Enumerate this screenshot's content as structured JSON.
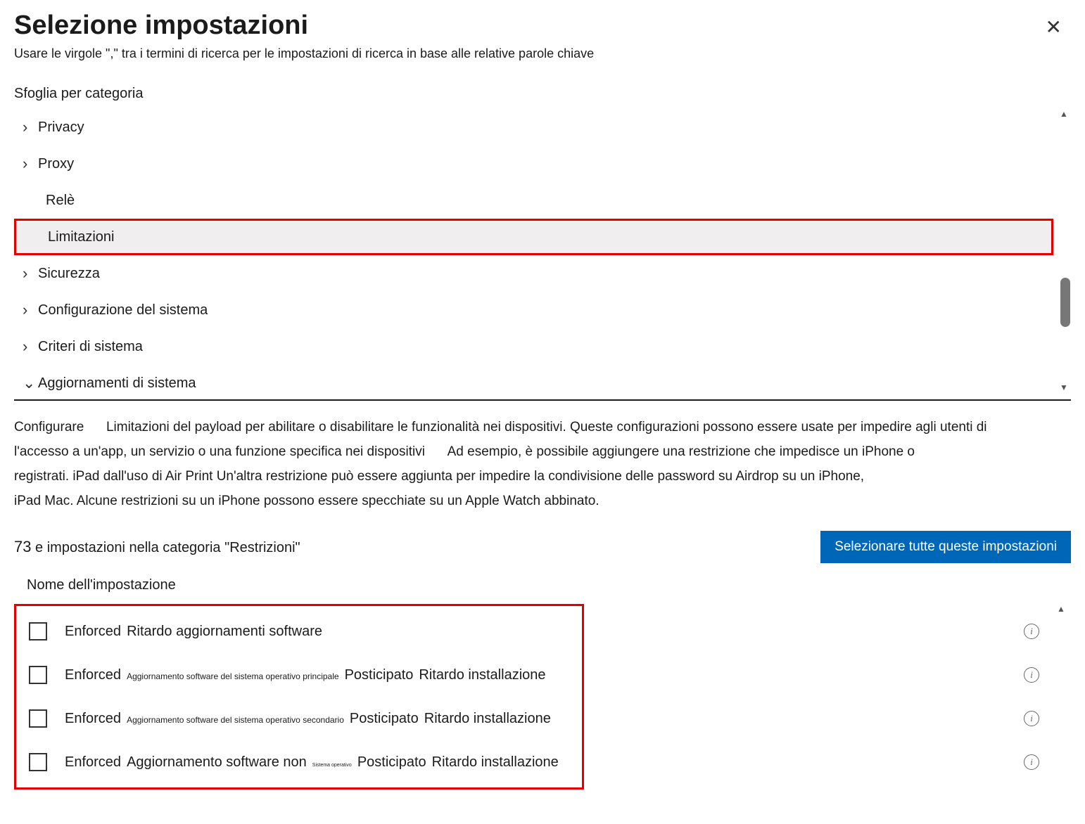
{
  "header": {
    "title": "Selezione impostazioni",
    "subtitle": "Usare le virgole \",\" tra i termini di ricerca per le impostazioni di ricerca in base alle relative parole chiave"
  },
  "browse_label": "Sfoglia per categoria",
  "categories": [
    {
      "label": "Privacy",
      "has_chevron": true
    },
    {
      "label": "Proxy",
      "has_chevron": true
    },
    {
      "label": "Relè",
      "has_chevron": false,
      "indented": true
    },
    {
      "label": "Limitazioni",
      "has_chevron": false,
      "indented": true,
      "selected": true
    },
    {
      "label": "Sicurezza",
      "has_chevron": true
    },
    {
      "label": "Configurazione del sistema",
      "has_chevron": true
    },
    {
      "label": "Criteri di sistema",
      "has_chevron": true
    },
    {
      "label": "Aggiornamenti di sistema",
      "has_chevron": true,
      "expanded": true
    }
  ],
  "description": {
    "line1_a": "Configurare",
    "line1_b": "Limitazioni del payload per abilitare o disabilitare le funzionalità nei dispositivi. Queste configurazioni possono essere usate per impedire agli utenti di",
    "line2_a": "l'accesso a un'app, un servizio o una funzione specifica nei dispositivi",
    "line2_b": "Ad esempio, è possibile aggiungere una restrizione che impedisce un iPhone o",
    "line3": "registrati. iPad dall'uso di Air Print Un'altra restrizione può essere aggiunta per impedire la condivisione delle password su Airdrop su un iPhone,",
    "line4": "iPad  Mac. Alcune restrizioni su un iPhone possono essere specchiate su un Apple Watch abbinato."
  },
  "count": {
    "num": "73",
    "text": "e impostazioni nella categoria \"Restrizioni\""
  },
  "select_all_btn": "Selezionare tutte queste impostazioni",
  "settings_header": "Nome dell'impostazione",
  "settings": [
    {
      "parts": [
        {
          "t": "Enforced",
          "s": "n"
        },
        {
          "t": "Ritardo aggiornamenti software",
          "s": "n"
        }
      ]
    },
    {
      "parts": [
        {
          "t": "Enforced",
          "s": "n"
        },
        {
          "t": "Aggiornamento software del sistema operativo principale",
          "s": "sm"
        },
        {
          "t": "Posticipato",
          "s": "n"
        },
        {
          "t": "Ritardo installazione",
          "s": "n"
        }
      ]
    },
    {
      "parts": [
        {
          "t": "Enforced",
          "s": "n"
        },
        {
          "t": "Aggiornamento software del sistema operativo secondario",
          "s": "sm"
        },
        {
          "t": "Posticipato",
          "s": "n"
        },
        {
          "t": "Ritardo installazione",
          "s": "n"
        }
      ]
    },
    {
      "parts": [
        {
          "t": "Enforced",
          "s": "n"
        },
        {
          "t": "Aggiornamento software non",
          "s": "n"
        },
        {
          "t": "Sistema operativo",
          "s": "ty"
        },
        {
          "t": "Posticipato",
          "s": "n"
        },
        {
          "t": "Ritardo installazione",
          "s": "n"
        }
      ]
    }
  ]
}
